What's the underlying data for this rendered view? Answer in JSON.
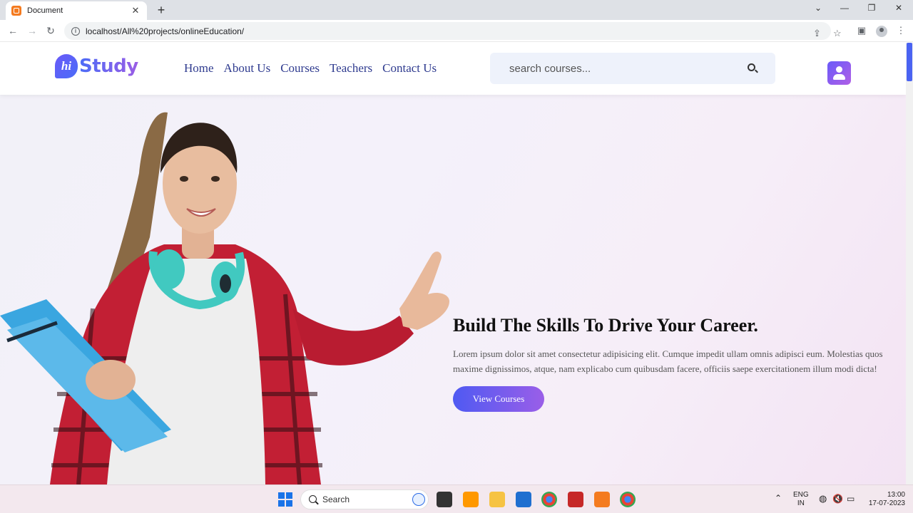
{
  "browser": {
    "tab_title": "Document",
    "url": "localhost/All%20projects/onlineEducation/"
  },
  "site": {
    "logo_mark": "hi",
    "logo_text": "Study",
    "nav": [
      "Home",
      "About Us",
      "Courses",
      "Teachers",
      "Contact Us"
    ],
    "search_placeholder": "search courses...",
    "accent": "#4f5af2",
    "accent2": "#9a5ee8"
  },
  "hero": {
    "title": "Build The Skills To Drive Your Career.",
    "text": "Lorem ipsum dolor sit amet consectetur adipisicing elit. Cumque impedit ullam omnis adipisci eum. Molestias quos maxime dignissimos, atque, nam explicabo cum quibusdam facere, officiis saepe exercitationem illum modi dicta!",
    "button": "View Courses"
  },
  "taskbar": {
    "search_label": "Search",
    "lang_top": "ENG",
    "lang_bottom": "IN",
    "time": "13:00",
    "date": "17-07-2023"
  }
}
